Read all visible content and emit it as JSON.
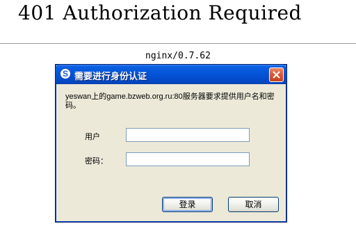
{
  "page": {
    "title": "401 Authorization Required",
    "server_signature": "nginx/0.7.62"
  },
  "dialog": {
    "title": "需要进行身份认证",
    "title_icon": "S",
    "message": "yeswan上的game.bzweb.org.ru:80服务器要求提供用户名和密码。",
    "username_label": "用户",
    "username_value": "",
    "password_label": "密码：",
    "password_value": "",
    "login_button": "登录",
    "cancel_button": "取消",
    "colors": {
      "titlebar": "#0453d8",
      "close": "#d8572f",
      "body": "#ece9d8"
    }
  }
}
